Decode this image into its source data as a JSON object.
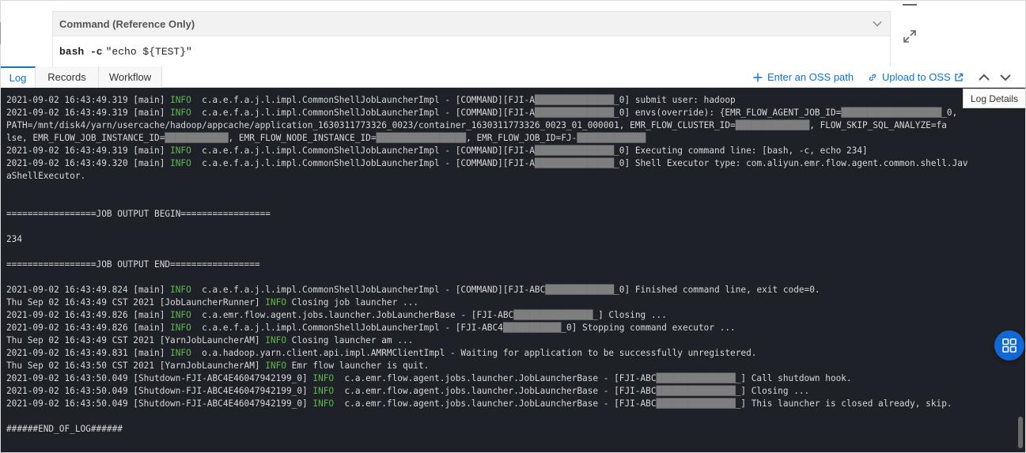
{
  "command_panel": {
    "title": "Command (Reference Only)",
    "cmd_keyword": "bash -c",
    "cmd_arg": "\"echo ${TEST}\""
  },
  "tabs": [
    {
      "label": "Log",
      "active": true
    },
    {
      "label": "Records",
      "active": false
    },
    {
      "label": "Workflow",
      "active": false
    }
  ],
  "toolbar": {
    "oss_path_label": "Enter an OSS path",
    "upload_label": "Upload to OSS",
    "tooltip": "Log Details"
  },
  "colors": {
    "accent": "#0a73d9",
    "console_bg": "#1f2128",
    "info": "#5eb84b",
    "fab": "#1167d4"
  },
  "icons": {
    "collapse": "chevron-down-icon",
    "expand": "expand-icon",
    "add": "plus-icon",
    "link": "link-icon",
    "external": "external-link-icon",
    "prev": "chevron-up-icon",
    "next": "chevron-down-icon",
    "fab": "grid-icon"
  },
  "log_lines": [
    [
      {
        "t": "2021-09-02 16:43:49.319 [main] "
      },
      {
        "t": "INFO",
        "lv": 1
      },
      {
        "t": "  c.a.e.f.a.j.l.impl.CommonShellJobLauncherImpl - [COMMAND][FJI-A"
      },
      {
        "t": "███████████████",
        "m": 1
      },
      {
        "t": "_0] submit user: hadoop"
      }
    ],
    [
      {
        "t": "2021-09-02 16:43:49.319 [main] "
      },
      {
        "t": "INFO",
        "lv": 1
      },
      {
        "t": "  c.a.e.f.a.j.l.impl.CommonShellJobLauncherImpl - [COMMAND][FJI-A"
      },
      {
        "t": "███████████████",
        "m": 1
      },
      {
        "t": "_0] envs(override): {EMR_FLOW_AGENT_JOB_ID="
      },
      {
        "t": "███████████████████",
        "m": 1
      },
      {
        "t": "_0,"
      }
    ],
    [
      {
        "t": "PATH=/mnt/disk4/yarn/usercache/hadoop/appcache/application_1630311773326_0023/container_1630311773326_0023_01_000001, EMR_FLOW_CLUSTER_ID="
      },
      {
        "t": "██████████████",
        "m": 1
      },
      {
        "t": ", FLOW_SKIP_SQL_ANALYZE=fa"
      }
    ],
    [
      {
        "t": "lse, EMR_FLOW_JOB_INSTANCE_ID="
      },
      {
        "t": "████████████",
        "m": 1
      },
      {
        "t": ", EMR_FLOW_NODE_INSTANCE_ID="
      },
      {
        "t": "█████████████████",
        "m": 1
      },
      {
        "t": ", EMR_FLOW_JOB_ID=FJ-"
      },
      {
        "t": "█████████████",
        "m": 1
      }
    ],
    [
      {
        "t": "2021-09-02 16:43:49.319 [main] "
      },
      {
        "t": "INFO",
        "lv": 1
      },
      {
        "t": "  c.a.e.f.a.j.l.impl.CommonShellJobLauncherImpl - [COMMAND][FJI-A"
      },
      {
        "t": "███████████████",
        "m": 1
      },
      {
        "t": "_0] Executing command line: [bash, -c, echo 234]"
      }
    ],
    [
      {
        "t": "2021-09-02 16:43:49.320 [main] "
      },
      {
        "t": "INFO",
        "lv": 1
      },
      {
        "t": "  c.a.e.f.a.j.l.impl.CommonShellJobLauncherImpl - [COMMAND][FJI-A"
      },
      {
        "t": "███████████████",
        "m": 1
      },
      {
        "t": "_0] Shell Executor type: com.aliyun.emr.flow.agent.common.shell.Jav"
      }
    ],
    [
      {
        "t": "aShellExecutor."
      }
    ],
    [
      {
        "t": ""
      }
    ],
    [
      {
        "t": ""
      }
    ],
    [
      {
        "t": "=================JOB OUTPUT BEGIN================="
      }
    ],
    [
      {
        "t": ""
      }
    ],
    [
      {
        "t": "234"
      }
    ],
    [
      {
        "t": ""
      }
    ],
    [
      {
        "t": "=================JOB OUTPUT END================="
      }
    ],
    [
      {
        "t": ""
      }
    ],
    [
      {
        "t": "2021-09-02 16:43:49.824 [main] "
      },
      {
        "t": "INFO",
        "lv": 1
      },
      {
        "t": "  c.a.e.f.a.j.l.impl.CommonShellJobLauncherImpl - [COMMAND][FJI-ABC"
      },
      {
        "t": "█████████████",
        "m": 1
      },
      {
        "t": "_0] Finished command line, exit code=0."
      }
    ],
    [
      {
        "t": "Thu Sep 02 16:43:49 CST 2021 [JobLauncherRunner] "
      },
      {
        "t": "INFO",
        "lv": 1
      },
      {
        "t": " Closing job launcher ..."
      }
    ],
    [
      {
        "t": "2021-09-02 16:43:49.826 [main] "
      },
      {
        "t": "INFO",
        "lv": 1
      },
      {
        "t": "  c.a.emr.flow.agent.jobs.launcher.JobLauncherBase - [FJI-ABC"
      },
      {
        "t": "███████████████",
        "m": 1
      },
      {
        "t": "_] Closing ..."
      }
    ],
    [
      {
        "t": "2021-09-02 16:43:49.826 [main] "
      },
      {
        "t": "INFO",
        "lv": 1
      },
      {
        "t": "  c.a.e.f.a.j.l.impl.CommonShellJobLauncherImpl - [FJI-ABC4"
      },
      {
        "t": "███████████",
        "m": 1
      },
      {
        "t": "_0] Stopping command executor ..."
      }
    ],
    [
      {
        "t": "Thu Sep 02 16:43:49 CST 2021 [YarnJobLauncherAM] "
      },
      {
        "t": "INFO",
        "lv": 1
      },
      {
        "t": " Closing launcher am ..."
      }
    ],
    [
      {
        "t": "2021-09-02 16:43:49.831 [main] "
      },
      {
        "t": "INFO",
        "lv": 1
      },
      {
        "t": "  o.a.hadoop.yarn.client.api.impl.AMRMClientImpl - Waiting for application to be successfully unregistered."
      }
    ],
    [
      {
        "t": "Thu Sep 02 16:43:50 CST 2021 [YarnJobLauncherAM] "
      },
      {
        "t": "INFO",
        "lv": 1
      },
      {
        "t": " Emr flow launcher is quit."
      }
    ],
    [
      {
        "t": "2021-09-02 16:43:50.049 [Shutdown-FJI-ABC4E46047942199_0] "
      },
      {
        "t": "INFO",
        "lv": 1
      },
      {
        "t": "  c.a.emr.flow.agent.jobs.launcher.JobLauncherBase - [FJI-ABC"
      },
      {
        "t": "███████████████",
        "m": 1
      },
      {
        "t": "_] Call shutdown hook."
      }
    ],
    [
      {
        "t": "2021-09-02 16:43:50.049 [Shutdown-FJI-ABC4E46047942199_0] "
      },
      {
        "t": "INFO",
        "lv": 1
      },
      {
        "t": "  c.a.emr.flow.agent.jobs.launcher.JobLauncherBase - [FJI-ABC"
      },
      {
        "t": "███████████████",
        "m": 1
      },
      {
        "t": "_] Closing ..."
      }
    ],
    [
      {
        "t": "2021-09-02 16:43:50.049 [Shutdown-FJI-ABC4E46047942199_0] "
      },
      {
        "t": "INFO",
        "lv": 1
      },
      {
        "t": "  c.a.emr.flow.agent.jobs.launcher.JobLauncherBase - [FJI-ABC"
      },
      {
        "t": "███████████████",
        "m": 1
      },
      {
        "t": "_] This launcher is closed already, skip."
      }
    ],
    [
      {
        "t": ""
      }
    ],
    [
      {
        "t": "######END_OF_LOG######"
      }
    ]
  ]
}
